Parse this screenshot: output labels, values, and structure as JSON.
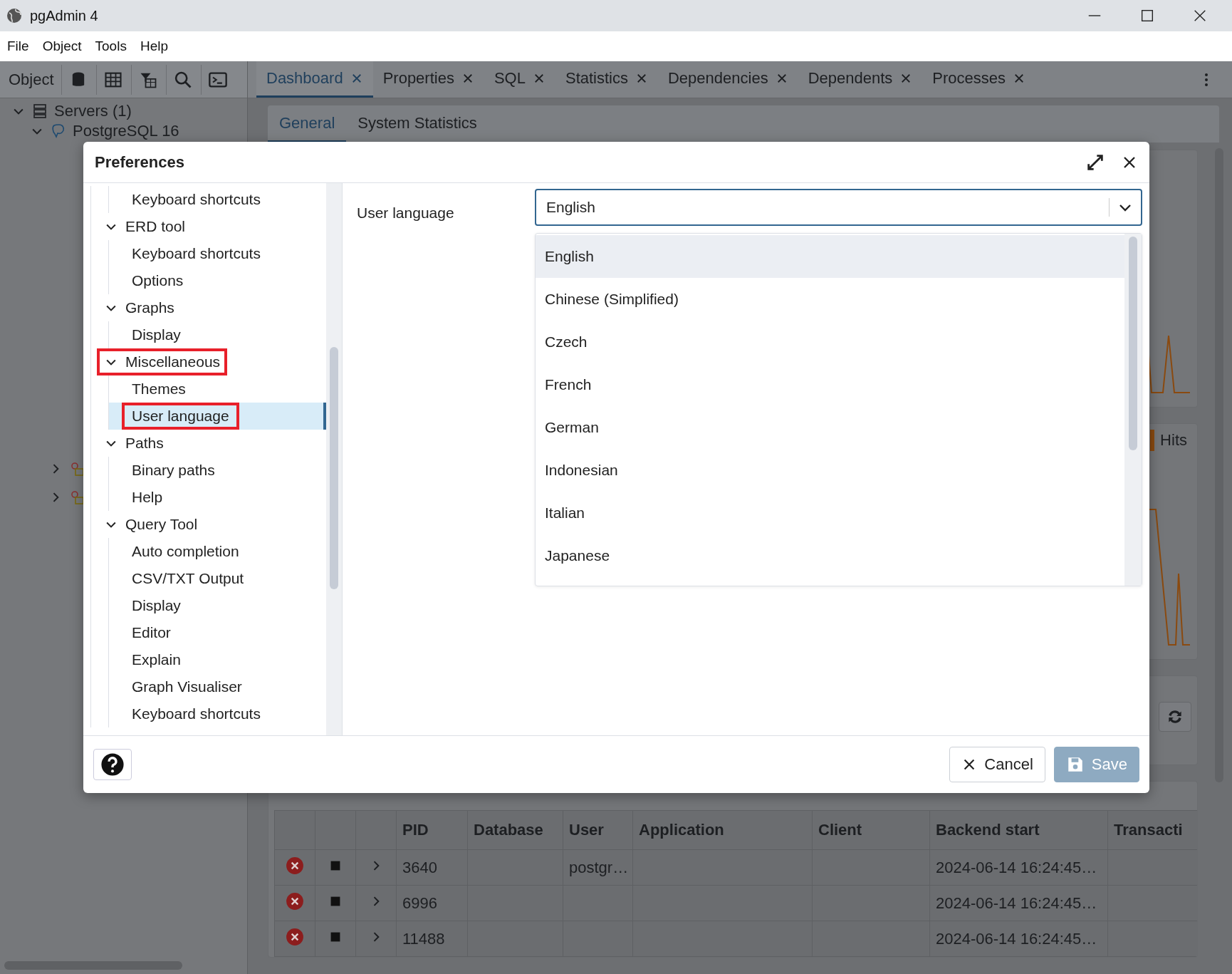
{
  "window": {
    "title": "pgAdmin 4"
  },
  "menu": [
    "File",
    "Object",
    "Tools",
    "Help"
  ],
  "object_explorer": {
    "label": "Object",
    "tree": [
      {
        "label": "Servers (1)",
        "expanded": true,
        "children": [
          {
            "label": "PostgreSQL 16",
            "expanded": true
          }
        ]
      }
    ]
  },
  "tabs": [
    {
      "label": "Dashboard",
      "selected": true
    },
    {
      "label": "Properties",
      "selected": false
    },
    {
      "label": "SQL",
      "selected": false
    },
    {
      "label": "Statistics",
      "selected": false
    },
    {
      "label": "Dependencies",
      "selected": false
    },
    {
      "label": "Dependents",
      "selected": false
    },
    {
      "label": "Processes",
      "selected": false
    }
  ],
  "subtabs": [
    {
      "label": "General",
      "selected": true
    },
    {
      "label": "System Statistics",
      "selected": false
    }
  ],
  "dashboard": {
    "legend": "Hits",
    "sessions": {
      "columns": [
        "PID",
        "Database",
        "User",
        "Application",
        "Client",
        "Backend start",
        "Transacti"
      ],
      "rows": [
        {
          "pid": "3640",
          "user": "postgr…",
          "backend_start": "2024-06-14 16:24:45…"
        },
        {
          "pid": "6996",
          "backend_start": "2024-06-14 16:24:45…"
        },
        {
          "pid": "11488",
          "backend_start": "2024-06-14 16:24:45…"
        }
      ]
    }
  },
  "preferences": {
    "title": "Preferences",
    "tree": [
      {
        "children": [
          {
            "label": "Keyboard shortcuts",
            "selected": false,
            "highlighted": false
          }
        ]
      },
      {
        "label": "ERD tool",
        "expanded": true,
        "selected": false,
        "highlighted": false,
        "children": [
          {
            "label": "Keyboard shortcuts",
            "selected": false,
            "highlighted": false
          },
          {
            "label": "Options",
            "selected": false,
            "highlighted": false
          }
        ]
      },
      {
        "label": "Graphs",
        "expanded": true,
        "selected": false,
        "highlighted": false,
        "children": [
          {
            "label": "Display",
            "selected": false,
            "highlighted": false
          }
        ]
      },
      {
        "label": "Miscellaneous",
        "expanded": true,
        "selected": false,
        "highlighted": true,
        "children": [
          {
            "label": "Themes",
            "selected": false,
            "highlighted": false
          },
          {
            "label": "User language",
            "selected": true,
            "highlighted": true
          }
        ]
      },
      {
        "label": "Paths",
        "expanded": true,
        "selected": false,
        "highlighted": false,
        "children": [
          {
            "label": "Binary paths",
            "selected": false,
            "highlighted": false
          },
          {
            "label": "Help",
            "selected": false,
            "highlighted": false
          }
        ]
      },
      {
        "label": "Query Tool",
        "expanded": true,
        "selected": false,
        "highlighted": false,
        "children": [
          {
            "label": "Auto completion",
            "selected": false,
            "highlighted": false
          },
          {
            "label": "CSV/TXT Output",
            "selected": false,
            "highlighted": false
          },
          {
            "label": "Display",
            "selected": false,
            "highlighted": false
          },
          {
            "label": "Editor",
            "selected": false,
            "highlighted": false
          },
          {
            "label": "Explain",
            "selected": false,
            "highlighted": false
          },
          {
            "label": "Graph Visualiser",
            "selected": false,
            "highlighted": false
          },
          {
            "label": "Keyboard shortcuts",
            "selected": false,
            "highlighted": false
          }
        ]
      }
    ],
    "setting": {
      "label": "User language",
      "value": "English",
      "expanded": true,
      "options": [
        {
          "label": "English",
          "selected": true
        },
        {
          "label": "Chinese (Simplified)",
          "selected": false
        },
        {
          "label": "Czech",
          "selected": false
        },
        {
          "label": "French",
          "selected": false
        },
        {
          "label": "German",
          "selected": false
        },
        {
          "label": "Indonesian",
          "selected": false
        },
        {
          "label": "Italian",
          "selected": false
        },
        {
          "label": "Japanese",
          "selected": false
        }
      ]
    },
    "buttons": [
      {
        "kind": "cancel",
        "label": "Cancel",
        "disabled": false
      },
      {
        "kind": "save",
        "label": "Save",
        "disabled": true
      }
    ]
  }
}
